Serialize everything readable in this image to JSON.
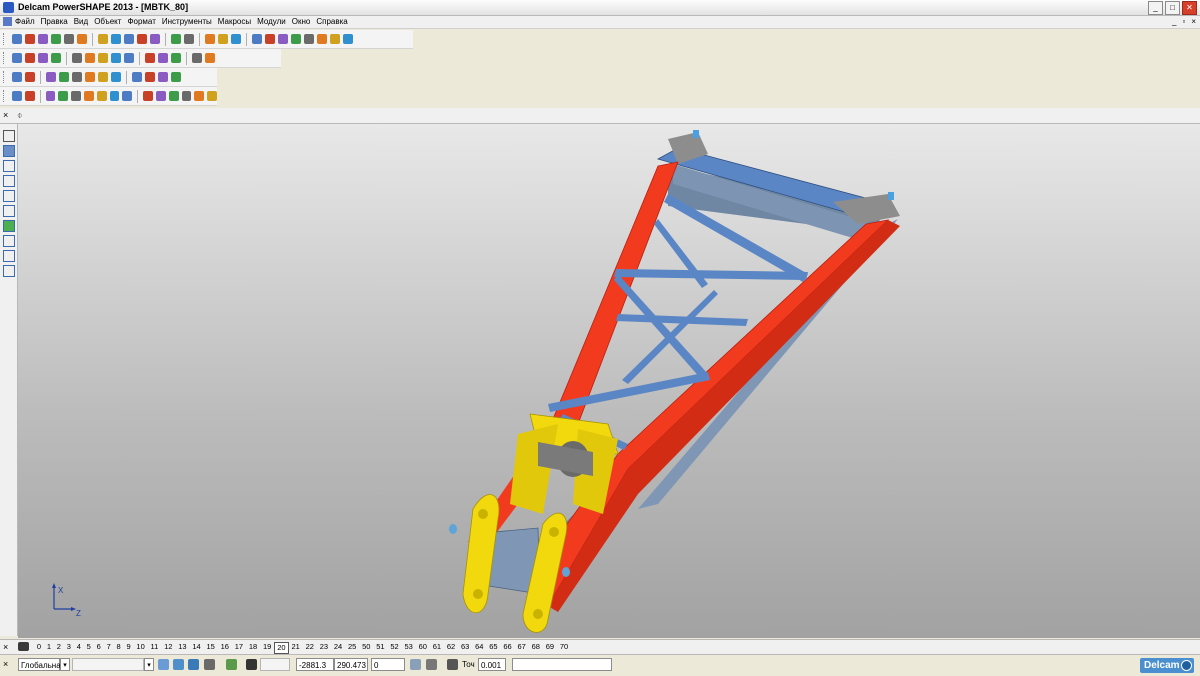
{
  "window": {
    "title": "Delcam PowerSHAPE 2013 - [MBTK_80]"
  },
  "menu": [
    "Файл",
    "Правка",
    "Вид",
    "Объект",
    "Формат",
    "Инструменты",
    "Макросы",
    "Модули",
    "Окно",
    "Справка"
  ],
  "window_buttons": [
    "_",
    "□",
    "✕"
  ],
  "mdi_buttons": [
    "_",
    "▫",
    "×"
  ],
  "toolbar1_icons": [
    "new-icon",
    "open-icon",
    "open-model-icon",
    "save-icon",
    "save-as-icon",
    "print-icon",
    "cut-icon",
    "copy-icon",
    "paste-icon",
    "copy-special-icon",
    "delete-icon",
    "undo-icon",
    "redo-icon",
    "edit-icon",
    "examine-icon",
    "workplane-icon",
    "select-icon",
    "circle-icon",
    "curve-icon",
    "text-icon",
    "solid-icon",
    "surface-icon",
    "edit-solid-icon",
    "tools-icon"
  ],
  "toolbar2_icons": [
    "view-top-icon",
    "view-front-icon",
    "view-iso-icon",
    "view-rotate-icon",
    "view-select-icon",
    "zoom-window-icon",
    "zoom-all-icon",
    "zoom-in-icon",
    "zoom-out-icon",
    "wireframe-icon",
    "shaded-icon",
    "shaded-wire-icon",
    "lights-icon",
    "material-icon"
  ],
  "toolbar3_icons": [
    "model-tree-icon",
    "document-icon",
    "sphere-icon",
    "shade-icon",
    "analysis-icon",
    "draft-icon",
    "section-icon",
    "measure-icon",
    "info-icon",
    "compare-icon",
    "check-icon",
    "export-icon"
  ],
  "toolbar4_icons": [
    "sketch-icon",
    "transform-icon",
    "box-icon",
    "cylinder-icon",
    "block-icon",
    "cone-icon",
    "torus-icon",
    "extrude-icon",
    "spin-icon",
    "feature-icon",
    "pattern-icon",
    "blend-icon",
    "fillet-icon",
    "chamfer-icon",
    "shell-icon"
  ],
  "left_tools": [
    "select-arrow-icon",
    "layer-icon",
    "line-icon",
    "curve-tool-icon",
    "rectangle-icon",
    "polygon-icon",
    "solid-box-icon",
    "dimension-icon",
    "arc-icon",
    "angle-icon"
  ],
  "axis": {
    "x": "X",
    "z": "Z"
  },
  "levels": {
    "close": "×",
    "items": [
      "0",
      "1",
      "2",
      "3",
      "4",
      "5",
      "6",
      "7",
      "8",
      "9",
      "10",
      "11",
      "12",
      "13",
      "14",
      "15",
      "16",
      "17",
      "18",
      "19",
      "20",
      "21",
      "22",
      "23",
      "24",
      "25",
      "50",
      "51",
      "52",
      "53",
      "60",
      "61",
      "62",
      "63",
      "64",
      "65",
      "66",
      "67",
      "68",
      "69",
      "70"
    ],
    "selected": "20"
  },
  "status": {
    "close": "×",
    "workplane": "Глобальна",
    "dropdown_arrow": "▾",
    "x_value": "-2881.3",
    "y_value": "290.473",
    "z_value": "0",
    "tolerance_label": "Точ",
    "tolerance_value": "0.001",
    "brand": "Delcam"
  },
  "colors": {
    "frame_red": "#f23a1f",
    "member_blue": "#5b86c6",
    "bracket_yellow": "#f1d90e",
    "steel_grey": "#8d8d8d"
  }
}
